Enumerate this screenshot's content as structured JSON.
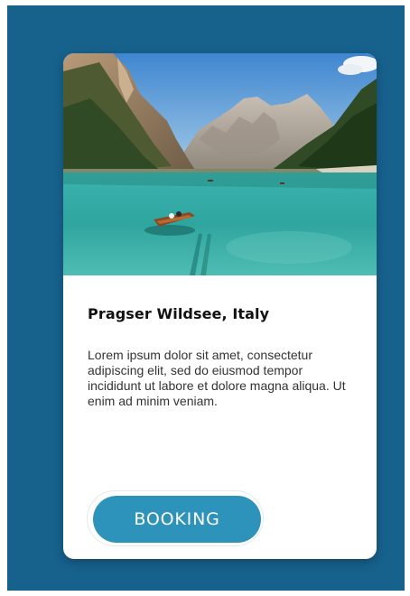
{
  "card": {
    "title": "Pragser Wildsee, Italy",
    "description": "Lorem ipsum dolor sit amet, consectetur adipiscing elit, sed do eiusmod tempor incididunt ut labore et dolore magna aliqua. Ut enim ad minim veniam.",
    "button_label": "BOOKING",
    "image_icon": "lake-landscape-photo"
  },
  "colors": {
    "page_background": "#17618d",
    "card_background": "#ffffff",
    "button": "#2e93bb",
    "button_text": "#ffffff",
    "title_text": "#111111",
    "body_text": "#333333"
  }
}
